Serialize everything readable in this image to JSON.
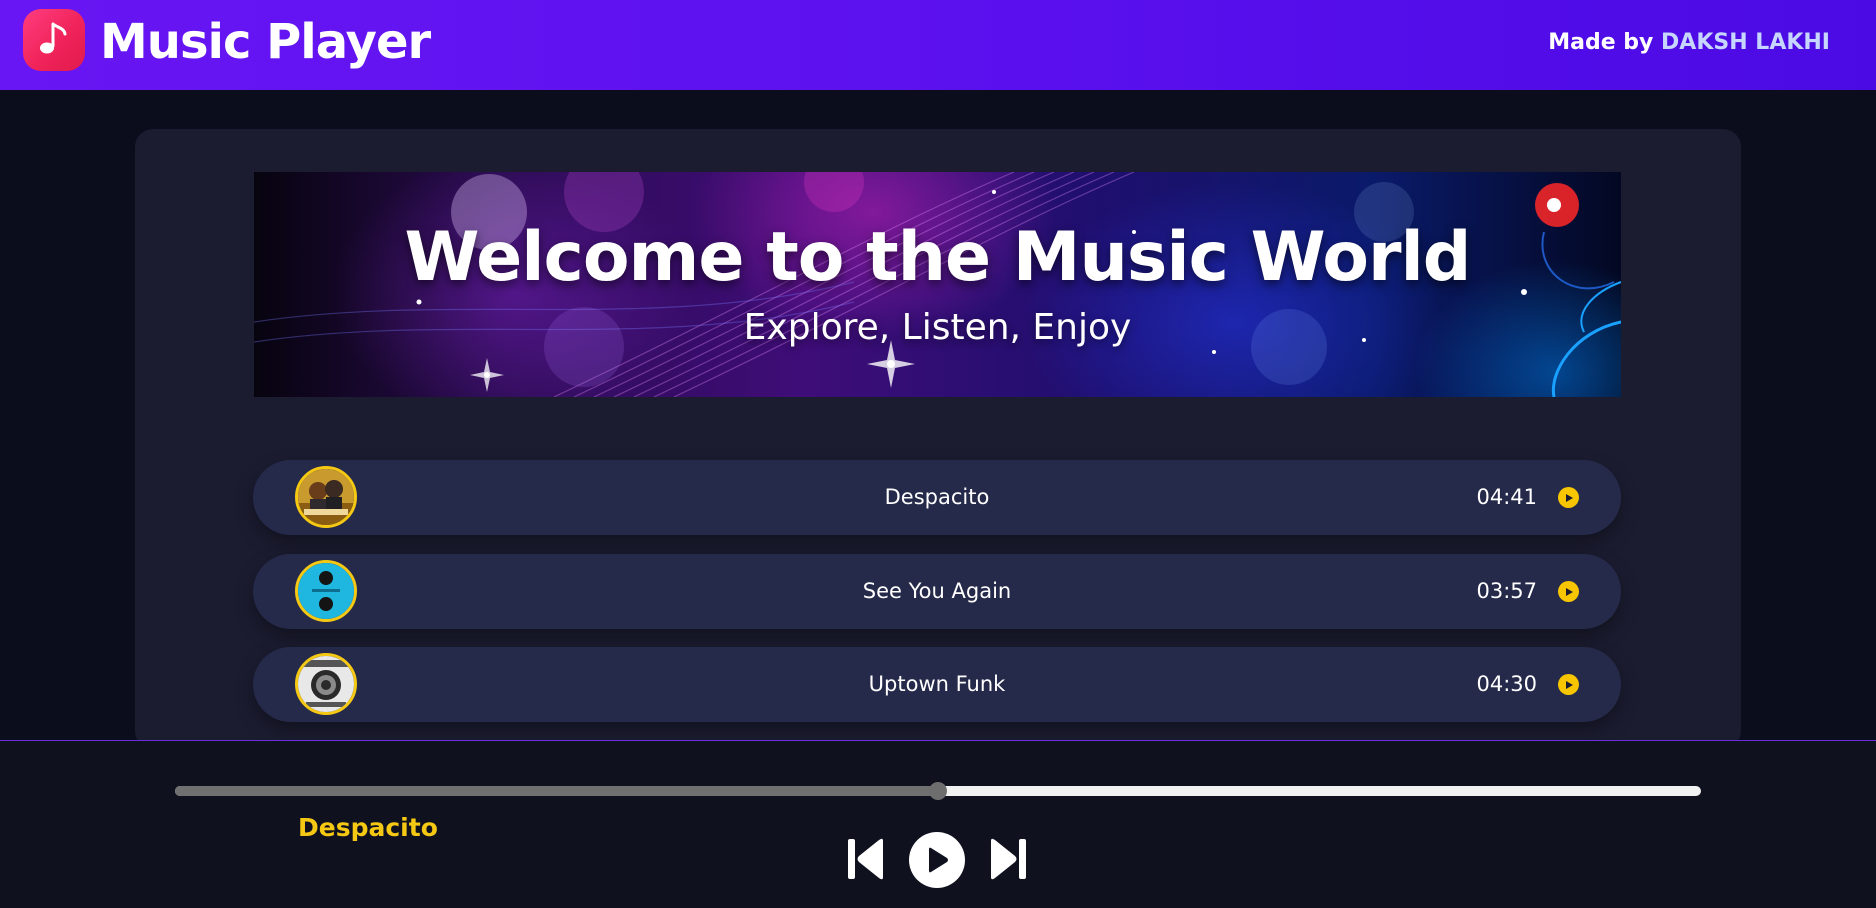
{
  "header": {
    "title": "Music Player",
    "credit_prefix": "Made by",
    "credit_author": "DAKSH LAKHI"
  },
  "banner": {
    "title": "Welcome to the Music World",
    "subtitle": "Explore, Listen, Enjoy"
  },
  "songs": [
    {
      "title": "Despacito",
      "duration": "04:41",
      "cover_icon": "despacito-cover-icon"
    },
    {
      "title": "See You Again",
      "duration": "03:57",
      "cover_icon": "see-you-again-cover-icon"
    },
    {
      "title": "Uptown Funk",
      "duration": "04:30",
      "cover_icon": "uptown-funk-cover-icon"
    }
  ],
  "player": {
    "now_playing": "Despacito",
    "progress_fraction": 0.5,
    "controls": [
      "previous-icon",
      "play-icon",
      "next-icon"
    ]
  },
  "colors": {
    "header_gradient_start": "#6816f3",
    "header_gradient_end": "#4b0ae4",
    "accent_yellow": "#f5c814",
    "row_background": "#262a4a",
    "panel_background": "#1b1c30",
    "page_background": "#0b0d1c",
    "credit_author": "#c6d6ff"
  }
}
